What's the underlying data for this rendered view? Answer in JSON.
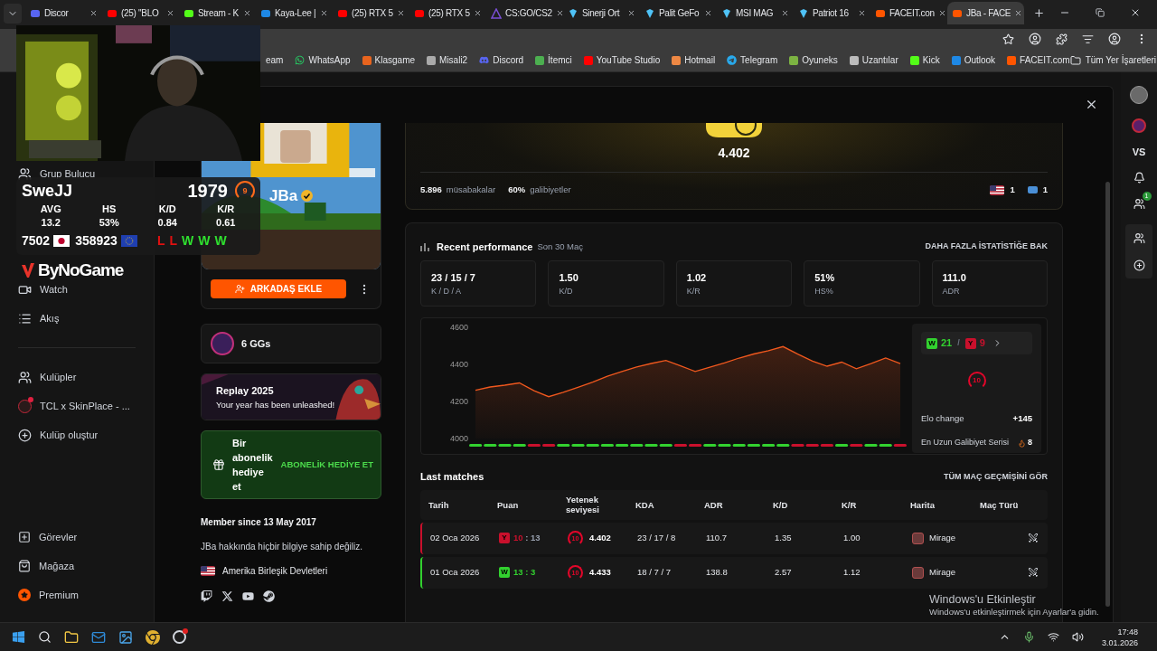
{
  "browser": {
    "tabs": [
      {
        "title": "Discor",
        "selected": false
      },
      {
        "title": "(25) \"BLO",
        "selected": false
      },
      {
        "title": "Stream - K",
        "selected": false
      },
      {
        "title": "Kaya-Lee |",
        "selected": false
      },
      {
        "title": "(25) RTX 5",
        "selected": false
      },
      {
        "title": "(25) RTX 5",
        "selected": false
      },
      {
        "title": "CS:GO/CS2",
        "selected": false
      },
      {
        "title": "Sinerji Ort",
        "selected": false
      },
      {
        "title": "Palit GeFo",
        "selected": false
      },
      {
        "title": "MSI MAG",
        "selected": false
      },
      {
        "title": "Patriot 16",
        "selected": false
      },
      {
        "title": "FACEIT.con",
        "selected": false
      },
      {
        "title": "JBa - FACE",
        "selected": true
      }
    ],
    "bookmarks": [
      "eam",
      "WhatsApp",
      "Klasgame",
      "Misali2",
      "Discord",
      "İtemci",
      "YouTube Studio",
      "Hotmail",
      "Telegram",
      "Oyuneks",
      "Uzantılar",
      "Kick",
      "Outlook",
      "FACEIT.com"
    ],
    "all_bookmarks": "Tüm Yer İşaretleri"
  },
  "stream_overlay": {
    "player": "SweJJ",
    "elo": "1979",
    "level": "9",
    "stats": [
      {
        "label": "AVG",
        "value": "13.2"
      },
      {
        "label": "HS",
        "value": "53%"
      },
      {
        "label": "K/D",
        "value": "0.84"
      },
      {
        "label": "K/R",
        "value": "0.61"
      }
    ],
    "rank": "7502",
    "region_rank": "358923",
    "recent": [
      {
        "result": "L",
        "won": false
      },
      {
        "result": "L",
        "won": false
      },
      {
        "result": "W",
        "won": true
      },
      {
        "result": "W",
        "won": true
      },
      {
        "result": "W",
        "won": true
      }
    ]
  },
  "brand": "ByNoGame",
  "sidebar": {
    "items": [
      "Grup Bulucu",
      "Watch",
      "Akış"
    ],
    "clubs": [
      {
        "label": "Kulüpler",
        "unread": false
      },
      {
        "label": "TCL x SkinPlace - ...",
        "unread": true
      },
      {
        "label": "Kulüp oluştur",
        "unread": false
      }
    ],
    "bottom": [
      "Görevler",
      "Mağaza",
      "Premium"
    ]
  },
  "profile": {
    "nickname": "JBa",
    "verified": true,
    "add_friend": "ARKADAŞ EKLE",
    "ggs": "6 GGs",
    "replay": {
      "title": "Replay 2025",
      "subtitle": "Your year has been unleashed!"
    },
    "gift": {
      "text": "Bir abonelik hediye et",
      "button": "ABONELİK HEDİYE ET"
    },
    "member_since": "Member since 13 May 2017",
    "about": "JBa hakkında hiçbir bilgiye sahip değiliz.",
    "country": "Amerika Birleşik Devletleri"
  },
  "elo_card": {
    "elo": "4.402",
    "matches": "5.896",
    "matches_label": "müsabakalar",
    "winrate": "60%",
    "winrate_label": "galibiyetler",
    "us_count": "1",
    "badge_count": "1"
  },
  "performance": {
    "title": "Recent performance",
    "subtitle": "Son 30 Maç",
    "link": "DAHA FAZLA İSTATİSTİĞE BAK",
    "tiles": [
      {
        "value": "23 / 15 / 7",
        "label": "K / D / A"
      },
      {
        "value": "1.50",
        "label": "K/D"
      },
      {
        "value": "1.02",
        "label": "K/R"
      },
      {
        "value": "51%",
        "label": "HS%"
      },
      {
        "value": "111.0",
        "label": "ADR"
      }
    ],
    "chart_data": {
      "type": "area",
      "ylim": [
        4000,
        4600
      ],
      "yticks": [
        4000,
        4200,
        4400,
        4600
      ],
      "series": [
        {
          "color": "#f0581e",
          "values": [
            4260,
            4278,
            4288,
            4300,
            4258,
            4226,
            4250,
            4276,
            4304,
            4336,
            4362,
            4386,
            4405,
            4421,
            4392,
            4362,
            4385,
            4408,
            4434,
            4456,
            4474,
            4496,
            4455,
            4418,
            4390,
            4412,
            4376,
            4404,
            4434,
            4404
          ]
        }
      ]
    },
    "results": [
      true,
      true,
      true,
      true,
      false,
      false,
      true,
      true,
      true,
      true,
      true,
      true,
      true,
      true,
      false,
      false,
      true,
      true,
      true,
      true,
      true,
      true,
      false,
      false,
      false,
      true,
      false,
      true,
      true,
      false
    ],
    "summary": {
      "win_badge": "W",
      "wins": "21",
      "separator": "/",
      "loss_badge": "Y",
      "losses": "9",
      "level": "10",
      "elo_change_label": "Elo change",
      "elo_change": "+145",
      "streak_label": "En Uzun Galibiyet Serisi",
      "streak": "8"
    }
  },
  "matches": {
    "title": "Last matches",
    "link": "TÜM MAÇ GEÇMİŞİNİ GÖR",
    "columns": [
      "Tarih",
      "Puan",
      "Yetenek seviyesi",
      "KDA",
      "ADR",
      "K/D",
      "K/R",
      "Harita",
      "Maç Türü"
    ],
    "rows": [
      {
        "date": "02 Oca 2026",
        "won": false,
        "badge": "Y",
        "score": "10",
        "separator": ":",
        "opp_score": "13",
        "level": "10",
        "elo": "4.402",
        "kda": "23 / 17 / 8",
        "adr": "110.7",
        "kd": "1.35",
        "kr": "1.00",
        "map": "Mirage"
      },
      {
        "date": "01 Oca 2026",
        "won": true,
        "badge": "W",
        "score": "13",
        "separator": ":",
        "opp_score": "3",
        "level": "10",
        "elo": "4.433",
        "kda": "18 / 7 / 7",
        "adr": "138.8",
        "kd": "2.57",
        "kr": "1.12",
        "map": "Mirage"
      }
    ]
  },
  "right_rail": {
    "vs": "VS",
    "friends_badge": "1"
  },
  "windows_activation": {
    "title": "Windows'u Etkinleştir",
    "text": "Windows'u etkinleştirmek için Ayarlar'a gidin."
  },
  "taskbar": {
    "time": "17:48",
    "date": "3.01.2026"
  }
}
